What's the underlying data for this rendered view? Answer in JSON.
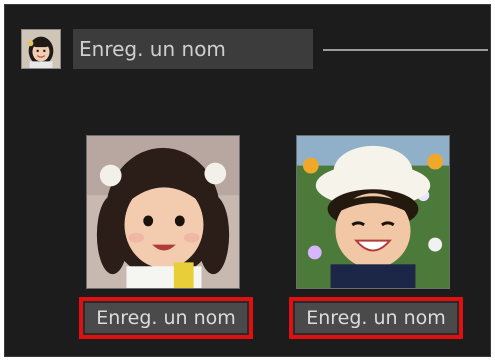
{
  "header": {
    "avatar_icon": "person-photo-icon",
    "name_value": "Enreg. un nom"
  },
  "faces": [
    {
      "name_value": "Enreg. un nom",
      "thumbnail_icon": "face-thumbnail-icon"
    },
    {
      "name_value": "Enreg. un nom",
      "thumbnail_icon": "face-thumbnail-icon"
    }
  ],
  "colors": {
    "panel_background": "#1c1c1c",
    "field_background": "#4a4a4a",
    "highlight_border": "#e01010",
    "text": "#dcdcdc"
  }
}
